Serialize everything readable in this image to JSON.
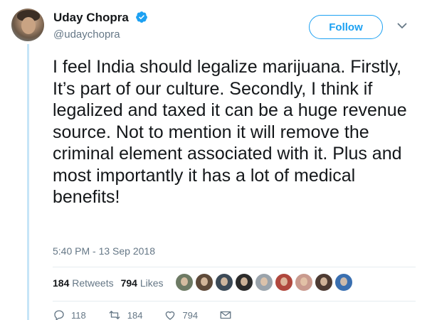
{
  "author": {
    "name": "Uday Chopra",
    "handle": "@udaychopra",
    "verified": true
  },
  "follow_button": {
    "label": "Follow"
  },
  "tweet": {
    "text": "I feel India should legalize marijuana. Firstly, It’s part of our culture. Secondly, I think if legalized and taxed it can be a huge revenue source. Not to mention it will remove the criminal element associated with it. Plus and most importantly it has a lot of medical benefits!",
    "timestamp": "5:40 PM - 13 Sep 2018"
  },
  "stats": {
    "retweets_count": "184",
    "retweets_label": "Retweets",
    "likes_count": "794",
    "likes_label": "Likes"
  },
  "likers": [
    {
      "color": "#6d7a64"
    },
    {
      "color": "#5e4a3a"
    },
    {
      "color": "#3c4a57"
    },
    {
      "color": "#2b2b2b"
    },
    {
      "color": "#9aa3ab"
    },
    {
      "color": "#b0473d"
    },
    {
      "color": "#c99a8e"
    },
    {
      "color": "#4d3b33"
    },
    {
      "color": "#3a6fb0"
    }
  ],
  "actions": {
    "reply_count": "118",
    "retweet_count": "184",
    "like_count": "794"
  },
  "colors": {
    "brand_blue": "#1da1f2",
    "thread_line": "#c6e5f7",
    "secondary_text": "#657786"
  }
}
